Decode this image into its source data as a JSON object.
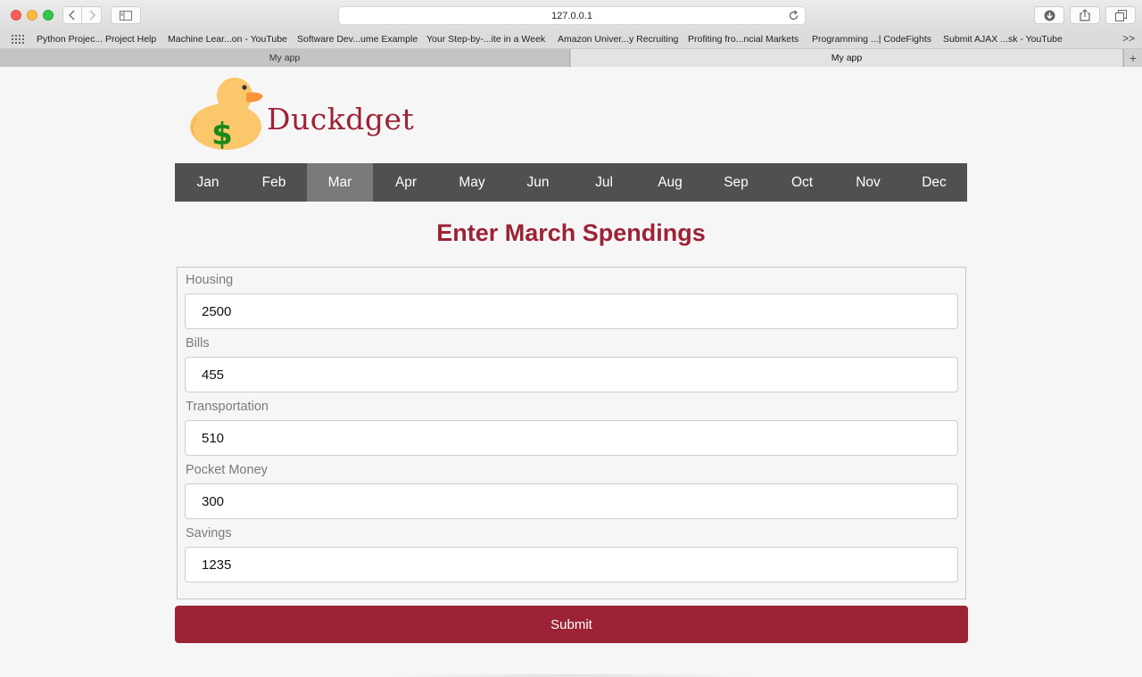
{
  "browser": {
    "url": "127.0.0.1",
    "bookmarks": [
      "Python Projec... Project Help",
      "Machine Lear...on - YouTube",
      "Software Dev...ume Example",
      "Your Step-by-...ite in a Week",
      "Amazon Univer...y Recruiting",
      "Profiting fro...ncial Markets",
      "Programming ...| CodeFights",
      "Submit AJAX ...sk - YouTube"
    ],
    "bookmarks_more": ">>",
    "tabs": [
      "My app",
      "My app"
    ],
    "new_tab": "+"
  },
  "app": {
    "brand": "Duckdget",
    "months": [
      "Jan",
      "Feb",
      "Mar",
      "Apr",
      "May",
      "Jun",
      "Jul",
      "Aug",
      "Sep",
      "Oct",
      "Nov",
      "Dec"
    ],
    "active_month": "Mar",
    "heading": "Enter March Spendings",
    "fields": [
      {
        "label": "Housing",
        "value": "2500"
      },
      {
        "label": "Bills",
        "value": "455"
      },
      {
        "label": "Transportation",
        "value": "510"
      },
      {
        "label": "Pocket Money",
        "value": "300"
      },
      {
        "label": "Savings",
        "value": "1235"
      }
    ],
    "submit_label": "Submit"
  },
  "colors": {
    "accent": "#9b2335",
    "nav_bg": "#505050",
    "nav_active": "#7a7a7a",
    "duck": "#fbc76b",
    "beak": "#f7943c",
    "dollar": "#1a8a1a"
  },
  "icons": {
    "logo": "duck-dollar-icon"
  }
}
